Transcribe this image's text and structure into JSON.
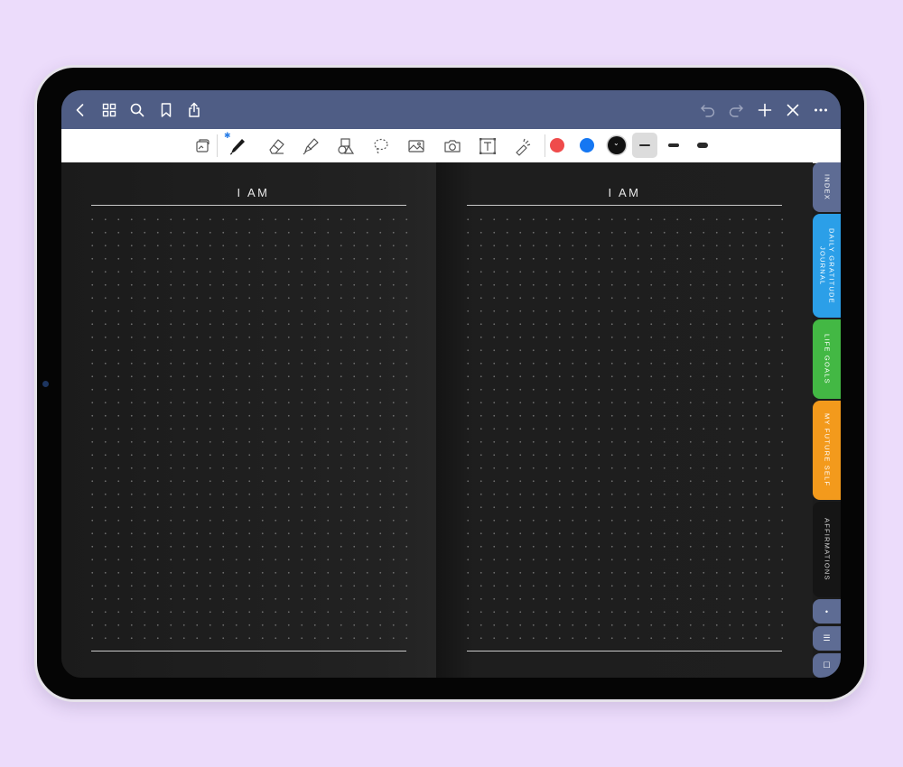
{
  "colors": {
    "background": "#ecdcfb",
    "topbar": "#4f5d85",
    "page": "#1e1e1e",
    "swatch_red": "#ef4b4b",
    "swatch_blue": "#1577f2",
    "swatch_black": "#111111"
  },
  "topbar": {
    "left_icons": [
      "back-chevron-icon",
      "thumbnail-grid-icon",
      "search-icon",
      "bookmark-icon",
      "share-icon"
    ],
    "right_icons": [
      "undo-icon",
      "redo-icon",
      "add-page-icon",
      "close-pen-icon",
      "more-icon"
    ]
  },
  "toolbar": {
    "tools": [
      "read-only-toggle-icon",
      "pen-icon",
      "eraser-icon",
      "highlighter-icon",
      "shapes-icon",
      "lasso-icon",
      "image-icon",
      "camera-icon",
      "text-icon",
      "laser-pointer-icon"
    ],
    "selected_tool": "pen-icon",
    "pen_colors": [
      "#ef4b4b",
      "#1577f2",
      "#111111"
    ],
    "stroke_sizes": [
      "fine",
      "medium",
      "thick"
    ],
    "selected_size": "fine"
  },
  "pages": [
    {
      "title": "I AM"
    },
    {
      "title": "I AM"
    }
  ],
  "tabs": [
    {
      "label": "INDEX",
      "color": "#5e6c94"
    },
    {
      "label": "DAILY GRATITUDE JOURNAL",
      "color": "#2b9fe8"
    },
    {
      "label": "LIFE GOALS",
      "color": "#43b844"
    },
    {
      "label": "MY FUTURE SELF",
      "color": "#f39a1c"
    },
    {
      "label": "AFFIRMATIONS",
      "color": "#151515"
    }
  ],
  "mini_tabs": [
    "•",
    "☰",
    "☐"
  ]
}
